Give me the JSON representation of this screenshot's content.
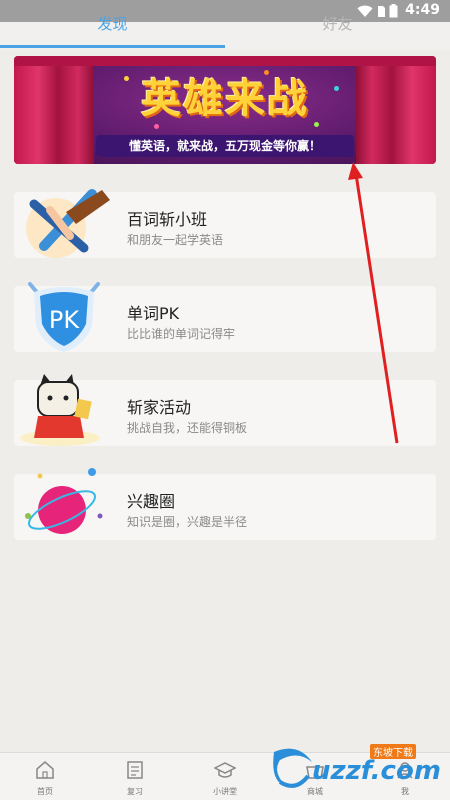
{
  "status_bar": {
    "time": "4:49"
  },
  "tabs": [
    {
      "label": "发现",
      "active": true
    },
    {
      "label": "好友",
      "active": false
    }
  ],
  "banner": {
    "title": "英雄来战",
    "subtitle": "懂英语，就来战，五万现金等你赢！"
  },
  "cards": [
    {
      "title": "百词斩小班",
      "desc": "和朋友一起学英语"
    },
    {
      "title": "单词PK",
      "desc": "比比谁的单词记得牢"
    },
    {
      "title": "斩家活动",
      "desc": "挑战自我，还能得铜板"
    },
    {
      "title": "兴趣圈",
      "desc": "知识是圈，兴趣是半径"
    }
  ],
  "bottom_nav": [
    {
      "label": "首页",
      "icon": "home-icon"
    },
    {
      "label": "复习",
      "icon": "notebook-icon"
    },
    {
      "label": "小讲堂",
      "icon": "graduation-cap-icon"
    },
    {
      "label": "商城",
      "icon": "shop-icon"
    },
    {
      "label": "我",
      "icon": "profile-icon"
    }
  ],
  "watermark": {
    "text": "uzzf.com",
    "tag": "东坡下载"
  },
  "colors": {
    "accent": "#4aa3e6",
    "annotation_arrow": "#e02020"
  }
}
